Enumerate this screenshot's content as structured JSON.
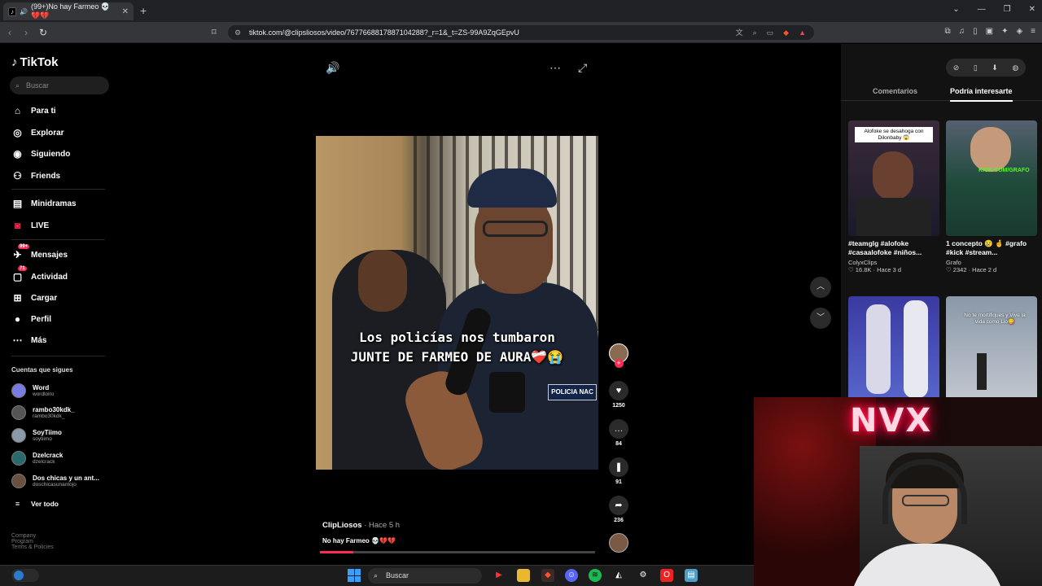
{
  "browser": {
    "tab_title": "(99+)No hay Farmeo 💀💔💔",
    "url": "tiktok.com/@clipsliosos/video/7677668817887104288?_r=1&_t=ZS-99A9ZqGEpvU",
    "new_tab": "+",
    "window_controls": [
      "⌄",
      "—",
      "❐",
      "✕"
    ]
  },
  "sidebar": {
    "logo": "TikTok",
    "search_placeholder": "Buscar",
    "nav": [
      {
        "label": "Para ti",
        "icon": "home-icon"
      },
      {
        "label": "Explorar",
        "icon": "compass-icon"
      },
      {
        "label": "Siguiendo",
        "icon": "following-icon"
      },
      {
        "label": "Friends",
        "icon": "friends-icon"
      },
      {
        "label": "Minidramas",
        "icon": "minidramas-icon"
      },
      {
        "label": "LIVE",
        "icon": "live-icon"
      },
      {
        "label": "Mensajes",
        "icon": "messages-icon",
        "badge": "99+"
      },
      {
        "label": "Actividad",
        "icon": "activity-icon",
        "badge": "71"
      },
      {
        "label": "Cargar",
        "icon": "upload-icon"
      },
      {
        "label": "Perfil",
        "icon": "profile-icon"
      },
      {
        "label": "Más",
        "icon": "more-icon"
      }
    ],
    "following_title": "Cuentas que sigues",
    "accounts": [
      {
        "name": "Word",
        "handle": "wordlolro"
      },
      {
        "name": "rambo30kdk_",
        "handle": "rambo30kdk_"
      },
      {
        "name": "SoyTiimo",
        "handle": "soytiimo"
      },
      {
        "name": "Dzelcrack",
        "handle": "dzelcrack"
      },
      {
        "name": "Dos chicas y un ant...",
        "handle": "doschicasunantojo"
      }
    ],
    "see_all": "Ver todo",
    "footer_1": "Company",
    "footer_2": "Program",
    "footer_3": "Terms & Policies"
  },
  "video": {
    "caption_line1": "Los policías nos tumbaron",
    "caption_line2": "JUNTE DE FARMEO DE AURA❤️‍🩹😭",
    "patch_text": "POLICIA NAC",
    "author": "ClipLiosos",
    "time": " · Hace 5 h",
    "description": "No hay Farmeo 💀💔💔",
    "progress": 0.12,
    "likes": "1250",
    "comments": "84",
    "saves": "91",
    "shares": "236"
  },
  "right_panel": {
    "tab_comments": "Comentarios",
    "tab_interest": "Podría interesarte",
    "cards": [
      {
        "label": "Alofoke se desahoga con Dilonbaby 😱",
        "caption": "#teamglg #alofoke #casaalofoke #niños...",
        "channel": "ColyxClips",
        "meta": "♡ 16.8K · Hace 3 d"
      },
      {
        "label": "KICK.COM/GRAFO",
        "caption": "1 concepto 😢 🤞 #grafo #kick #stream...",
        "channel": "Grafo",
        "meta": "♡ 2342 · Hace 2 d"
      },
      {
        "label": "",
        "caption": "",
        "channel": "",
        "meta": ""
      },
      {
        "label": "No te mortifiques y Vive la vida como Lio😋",
        "caption": "",
        "channel": "",
        "meta": ""
      }
    ]
  },
  "overlay": {
    "neon": "NVX"
  },
  "taskbar": {
    "search": "Buscar"
  },
  "colors": {
    "accent": "#fe2c55",
    "bg": "#000000",
    "panel": "#121212"
  }
}
